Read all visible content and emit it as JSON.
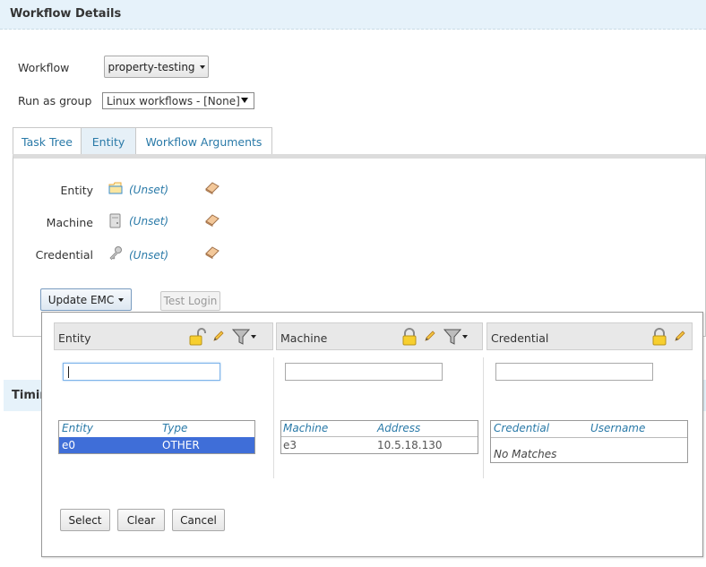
{
  "header": {
    "title": "Workflow Details"
  },
  "workflow": {
    "label": "Workflow",
    "value": "property-testing"
  },
  "run_as_group": {
    "label": "Run as group",
    "value": "Linux workflows - [None]"
  },
  "tabs": [
    {
      "label": "Task Tree"
    },
    {
      "label": "Entity"
    },
    {
      "label": "Workflow Arguments"
    }
  ],
  "entity_fields": [
    {
      "label": "Entity",
      "value": "(Unset)",
      "icon": "folder-icon"
    },
    {
      "label": "Machine",
      "value": "(Unset)",
      "icon": "server-icon"
    },
    {
      "label": "Credential",
      "value": "(Unset)",
      "icon": "key-icon"
    }
  ],
  "actions": {
    "update_emc": "Update EMC",
    "test_login": "Test Login"
  },
  "timing_section": {
    "label": "Timin"
  },
  "picker": {
    "entity": {
      "title": "Entity",
      "search_value": "",
      "columns": [
        "Entity",
        "Type"
      ],
      "rows": [
        {
          "name": "e0",
          "type": "OTHER",
          "selected": true
        }
      ]
    },
    "machine": {
      "title": "Machine",
      "search_value": "",
      "columns": [
        "Machine",
        "Address"
      ],
      "rows": [
        {
          "name": "e3",
          "address": "10.5.18.130"
        }
      ]
    },
    "credential": {
      "title": "Credential",
      "search_value": "",
      "columns": [
        "Credential",
        "Username"
      ],
      "empty_text": "No Matches"
    },
    "buttons": {
      "select": "Select",
      "clear": "Clear",
      "cancel": "Cancel"
    }
  },
  "colors": {
    "link": "#2a7aa8",
    "header_bg": "#e6f2fa",
    "selection": "#3f6ed8"
  }
}
